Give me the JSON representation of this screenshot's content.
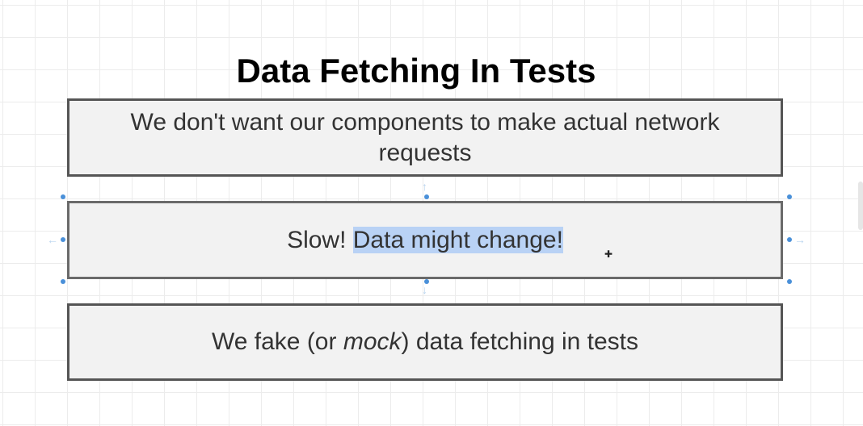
{
  "title": "Data Fetching In Tests",
  "boxes": {
    "box1": "We don't want our components to make actual network requests",
    "box2_pre": "Slow! ",
    "box2_highlight": "Data might change!",
    "box3_pre": "We fake (or ",
    "box3_em": "mock",
    "box3_post": ") data fetching in tests"
  },
  "colors": {
    "box_fill": "#f2f2f2",
    "box_border": "#555555",
    "selection_highlight": "#b9d2f5",
    "handle": "#4a90d9"
  }
}
